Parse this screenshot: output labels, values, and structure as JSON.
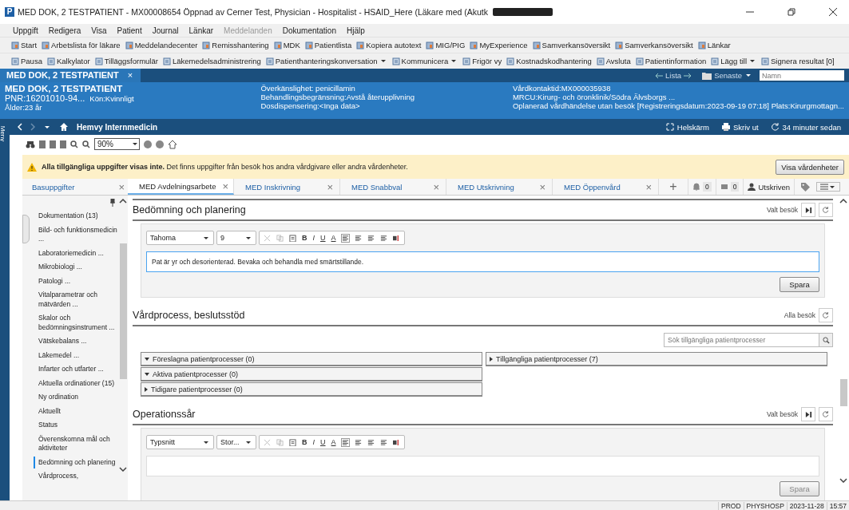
{
  "window": {
    "logo": "P",
    "title": "MED DOK, 2 TESTPATIENT - MX00008654 Öppnad av Cerner Test, Physician - Hospitalist - HSAID_Here (Läkare med (Akutk"
  },
  "menu": [
    {
      "label": "Uppgift",
      "disabled": false
    },
    {
      "label": "Redigera",
      "disabled": false
    },
    {
      "label": "Visa",
      "disabled": false
    },
    {
      "label": "Patient",
      "disabled": false
    },
    {
      "label": "Journal",
      "disabled": false
    },
    {
      "label": "Länkar",
      "disabled": false
    },
    {
      "label": "Meddelanden",
      "disabled": true
    },
    {
      "label": "Dokumentation",
      "disabled": false
    },
    {
      "label": "Hjälp",
      "disabled": false
    }
  ],
  "toolbar_1": [
    {
      "label": "Start",
      "dropdown": false
    },
    {
      "label": "Arbetslista för läkare",
      "dropdown": false
    },
    {
      "label": "Meddelandecenter",
      "dropdown": false
    },
    {
      "label": "Remisshantering",
      "dropdown": false
    },
    {
      "label": "MDK",
      "dropdown": false
    },
    {
      "label": "Patientlista",
      "dropdown": false
    },
    {
      "label": "Kopiera autotext",
      "dropdown": false
    },
    {
      "label": "MIG/PIG",
      "dropdown": false
    },
    {
      "label": "MyExperience",
      "dropdown": false
    },
    {
      "label": "Samverkansöversikt",
      "dropdown": false
    },
    {
      "label": "Samverkansöversikt",
      "dropdown": false
    },
    {
      "label": "Länkar",
      "dropdown": false
    }
  ],
  "toolbar_2": [
    {
      "label": "Pausa",
      "dropdown": false
    },
    {
      "label": "Kalkylator",
      "dropdown": false
    },
    {
      "label": "Tilläggsformulär",
      "dropdown": false
    },
    {
      "label": "Läkemedelsadministrering",
      "dropdown": false
    },
    {
      "label": "Patienthanteringskonversation",
      "dropdown": true
    },
    {
      "label": "Kommunicera",
      "dropdown": true
    },
    {
      "label": "Frigör vy",
      "dropdown": false
    },
    {
      "label": "Kostnadskodhantering",
      "dropdown": false
    },
    {
      "label": "Avsluta",
      "dropdown": false
    },
    {
      "label": "Patientinformation",
      "dropdown": false
    },
    {
      "label": "Lägg till",
      "dropdown": true
    },
    {
      "label": "Signera resultat [0]",
      "dropdown": false
    }
  ],
  "patient_tab": {
    "label": "MED DOK, 2 TESTPATIENT",
    "close": "×"
  },
  "patient_nav": {
    "back": "Lista",
    "recent": "Senaste",
    "search": {
      "placeholder": "Namn"
    }
  },
  "banner": {
    "name": "MED DOK, 2 TESTPATIENT",
    "pnr": "PNR:16201010-94...",
    "sex": "Kön:Kvinnligt",
    "age": "Ålder:23 år",
    "column_2": [
      "Överkänslighet: penicillamin",
      "Behandlingsbegränsning:Avstå återupplivning",
      "Dosdispensering:<Inga data>"
    ],
    "column_3": [
      "Vårdkontaktid:MX000035938",
      "MRCU:Kirurg- och öronklinik/Södra Älvsborgs ...",
      "Oplanerad vårdhändelse utan besök [Registreringsdatum:2023-09-19 07:18] Plats:Kirurgmottagn..."
    ]
  },
  "side_strip": "Meny",
  "nav": {
    "title": "Hemvy Internmedicin",
    "fullscreen": "Helskärm",
    "print": "Skriv ut",
    "updated": "34 minuter sedan"
  },
  "zoom": {
    "value": "90%"
  },
  "warning": {
    "text": "**Alla tillgängliga uppgifter visas inte.** Det finns uppgifter från besök hos andra vårdgivare eller andra vårdenheter.",
    "button": "Visa vårdenheter"
  },
  "sidebar": {
    "title": "Basuppgifter",
    "close": "×",
    "items": [
      {
        "label": "Dokumentation",
        "count": "(13)",
        "selected": false
      },
      {
        "label": "Bild- och funktionsmedicin ...",
        "selected": false
      },
      {
        "label": "Laboratoriemedicin ...",
        "selected": false
      },
      {
        "label": "Mikrobiologi ...",
        "selected": false
      },
      {
        "label": "Patologi ...",
        "selected": false
      },
      {
        "label": "Vitalparametrar och mätvärden ...",
        "selected": false
      },
      {
        "label": "Skalor och bedömningsinstrument ...",
        "selected": false
      },
      {
        "label": "Vätskebalans ...",
        "selected": false
      },
      {
        "label": "Läkemedel ...",
        "selected": false
      },
      {
        "label": "Infarter och utfarter ...",
        "selected": false
      },
      {
        "label": "Aktuella ordinationer",
        "count": "(15)",
        "selected": false
      },
      {
        "label": "Ny ordination",
        "selected": false
      },
      {
        "label": "Aktuellt",
        "selected": false
      },
      {
        "label": "Status",
        "selected": false
      },
      {
        "label": "Överenskomna mål och aktiviteter",
        "selected": false
      },
      {
        "label": "Bedömning och planering",
        "selected": true
      },
      {
        "label": "Vårdprocess,",
        "selected": false
      }
    ]
  },
  "tabs": [
    {
      "label": "MED Avdelningsarbete",
      "selected": true,
      "close": "×"
    },
    {
      "label": "MED Inskrivning",
      "selected": false,
      "close": "×"
    },
    {
      "label": "MED Snabbval",
      "selected": false,
      "close": "×"
    },
    {
      "label": "MED Utskrivning",
      "selected": false,
      "close": "×"
    },
    {
      "label": "MED Öppenvård",
      "selected": false,
      "close": "×"
    }
  ],
  "tab_add": "+",
  "tab_tools": {
    "notifications": "0",
    "messages": "0",
    "status": "Utskriven"
  },
  "sections": [
    {
      "kind": "editor",
      "title": "Bedömning och planering",
      "scope": "Valt besök",
      "font": "Tahoma",
      "size": "9",
      "format": [
        "B",
        "I",
        "U",
        "A"
      ],
      "value": "Pat är yr och desorienterad. Bevaka och behandla med smärtstillande.",
      "save": "Spara",
      "save_disabled": false
    },
    {
      "kind": "process",
      "title": "Vårdprocess, beslutsstöd",
      "scope": "Alla besök",
      "search": {
        "placeholder": "Sök tillgängliga patientprocesser"
      },
      "left": [
        {
          "label": "Föreslagna patientprocesser (0)",
          "expanded": true
        },
        {
          "label": "Aktiva patientprocesser (0)",
          "expanded": true
        },
        {
          "label": "Tidigare patientprocesser (0)",
          "expanded": false
        }
      ],
      "right": [
        {
          "label": "Tillgängliga patientprocesser (7)",
          "expanded": false
        }
      ]
    },
    {
      "kind": "editor",
      "title": "Operationssår",
      "scope": "Valt besök",
      "font": "Typsnitt",
      "size": "Stor...",
      "format": [
        "B",
        "I",
        "U",
        "A"
      ],
      "save": "Spara",
      "save_disabled": true
    }
  ],
  "status_bar": [
    "PROD",
    "PHYSHOSP",
    "2023-11-28",
    "15:57"
  ]
}
